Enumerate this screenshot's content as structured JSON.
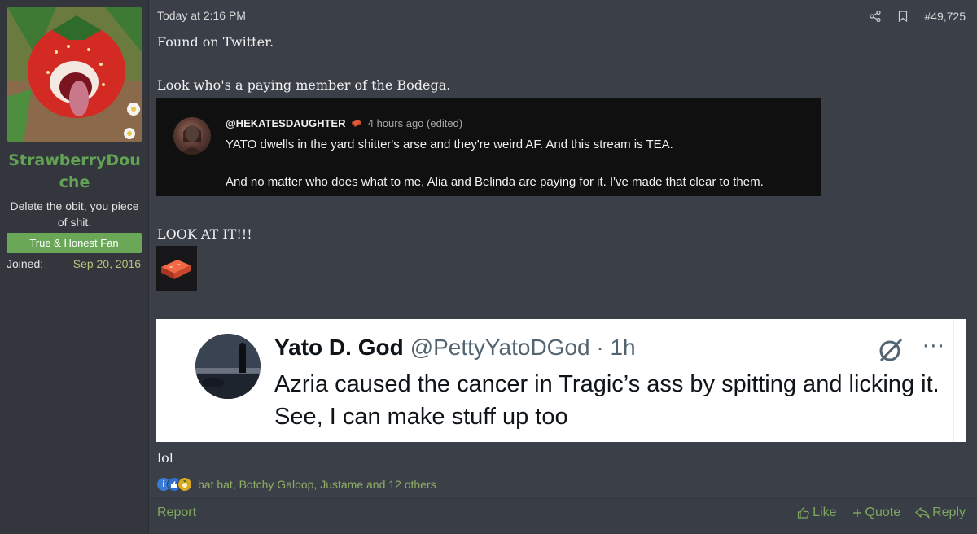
{
  "user": {
    "username": "StrawberryDouche",
    "user_title": "Delete the obit, you piece of shit.",
    "banner": "True & Honest Fan",
    "joined_label": "Joined:",
    "joined_value": "Sep 20, 2016"
  },
  "post": {
    "timestamp": "Today at 2:16 PM",
    "post_number": "#49,725",
    "paragraph1": "Found on Twitter.",
    "paragraph2": "Look who's a paying member of the Bodega.",
    "paragraph3": "LOOK AT IT!!!",
    "paragraph4": "lol"
  },
  "embedded_comment": {
    "handle": "@HEKATESDAUGHTER",
    "time": "4 hours ago (edited)",
    "line1": "YATO dwells in the yard shitter's arse and they're weird AF. And this stream is TEA.",
    "line2": "And no matter who does what to me, Alia and Belinda are paying for it. I've made that clear to them."
  },
  "tweet": {
    "display_name": "Yato D. God",
    "handle_time": "@PettyYatoDGod · 1h",
    "text": "Azria caused the cancer in Tragic’s ass by spitting and licking it. See, I can make stuff up too",
    "more": "···"
  },
  "reactions": {
    "icons": [
      "informative-icon",
      "like-icon",
      "medal-icon"
    ],
    "list": "bat bat, Botchy Galoop, Justame and 12 others"
  },
  "footer": {
    "report": "Report",
    "like": "Like",
    "quote": "Quote",
    "reply": "Reply"
  },
  "colors": {
    "background": "#3b3f48",
    "sidebar": "#33363d",
    "username": "#63a154",
    "banner": "#6aa857",
    "link_green": "#7fa85f"
  }
}
